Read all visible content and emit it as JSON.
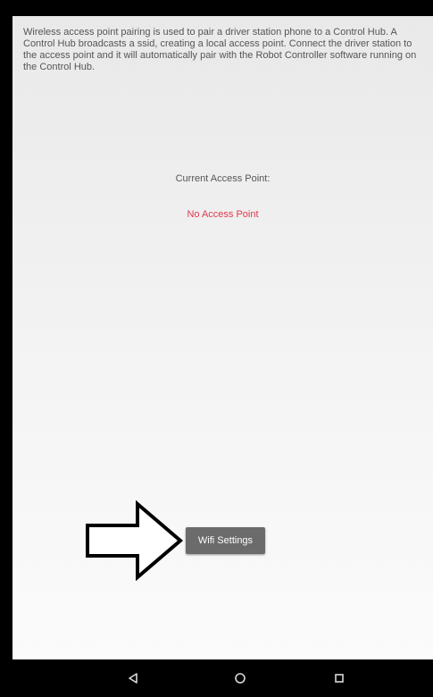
{
  "description": "Wireless access point pairing is used to pair a driver station phone to a Control Hub. A Control Hub broadcasts a ssid, creating a local access point. Connect the driver station to the access point and it will automatically pair with the Robot Controller software running on the Control Hub.",
  "access_point": {
    "label": "Current Access Point:",
    "value": "No Access Point"
  },
  "wifi_settings_button": {
    "label": "Wifi Settings"
  },
  "navigation_bar": {
    "icons": [
      "back-icon",
      "home-icon",
      "recents-icon"
    ]
  },
  "colors": {
    "status_red": "#e0384f",
    "button_gray": "#6b6b6b",
    "frame_black": "#000000"
  }
}
